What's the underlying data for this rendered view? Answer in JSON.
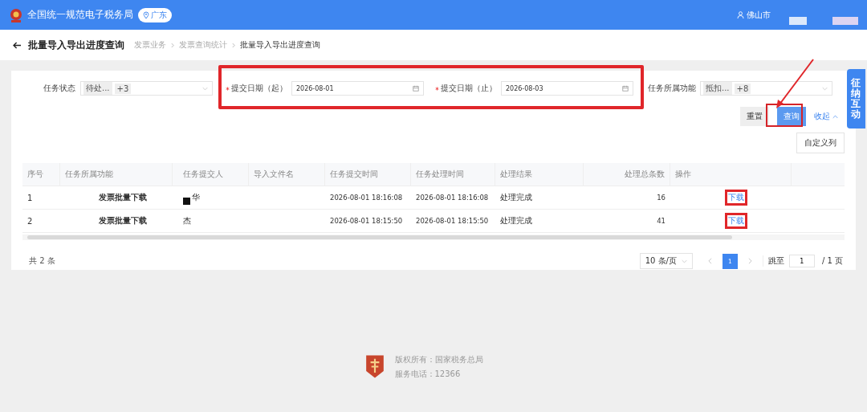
{
  "header": {
    "site_title": "全国统一规范电子税务局",
    "region": "广东",
    "user": "佛山市"
  },
  "page": {
    "title": "批量导入导出进度查询",
    "breadcrumb": [
      "发票业务",
      "发票查询统计",
      "批量导入导出进度查询"
    ]
  },
  "filters": [
    {
      "kind": "select",
      "label": "任务状态",
      "tags": [
        "待处...",
        "+3"
      ]
    },
    {
      "kind": "date",
      "label": "提交日期（起）",
      "required": true,
      "value": "2026-08-01"
    },
    {
      "kind": "date",
      "label": "提交日期（止）",
      "required": true,
      "value": "2026-08-03"
    },
    {
      "kind": "select",
      "label": "任务所属功能",
      "tags": [
        "抵扣...",
        "+8"
      ]
    }
  ],
  "actions": {
    "reset": "重置",
    "query": "查询",
    "collapse": "收起"
  },
  "customize_columns": "自定义列",
  "table": {
    "columns": [
      "序号",
      "任务所属功能",
      "任务提交人",
      "导入文件名",
      "任务提交时间",
      "任务处理时间",
      "处理结果",
      "处理总条数",
      "操作"
    ],
    "rows": [
      {
        "index": "1",
        "function": "发票批量下载",
        "submitter": "华",
        "file": "",
        "submitted": "2026-08-01 18:16:08",
        "processed": "2026-08-01 18:16:08",
        "result": "处理完成",
        "count": "16",
        "action": "下载"
      },
      {
        "index": "2",
        "function": "发票批量下载",
        "submitter": "杰",
        "file": "",
        "submitted": "2026-08-01 18:15:50",
        "processed": "2026-08-01 18:15:50",
        "result": "处理完成",
        "count": "41",
        "action": "下载"
      }
    ]
  },
  "pagination": {
    "total": "共 2 条",
    "page_size": "10 条/页",
    "pages": [
      {
        "label": "1",
        "selected": true
      }
    ],
    "jump_label": "跳至",
    "jump_value": "1",
    "page_count": "/ 1 页"
  },
  "side_tab": "征纳互动",
  "footer": {
    "copyright": "版权所有：国家税务总局",
    "phone": "服务电话：12366"
  }
}
